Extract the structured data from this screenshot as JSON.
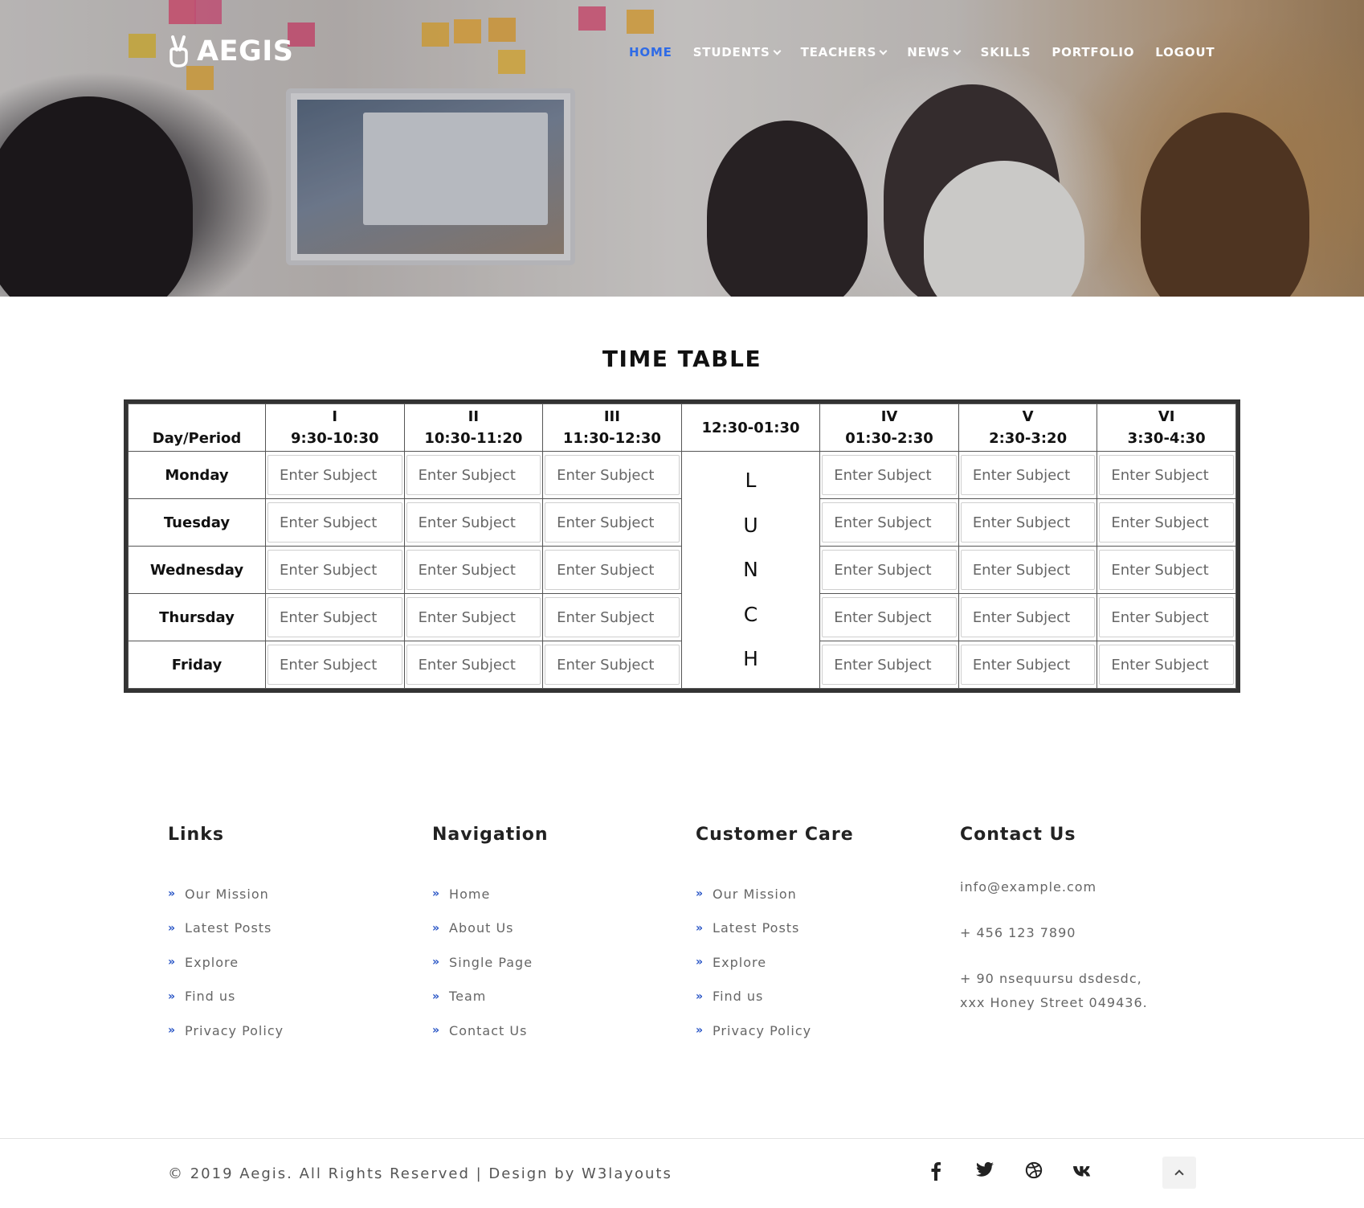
{
  "brand": {
    "name": "AEGIS",
    "icon": "victory-hand-icon"
  },
  "nav": {
    "items": [
      {
        "label": "HOME",
        "active": true,
        "dropdown": false
      },
      {
        "label": "STUDENTS",
        "active": false,
        "dropdown": true
      },
      {
        "label": "TEACHERS",
        "active": false,
        "dropdown": true
      },
      {
        "label": "NEWS",
        "active": false,
        "dropdown": true
      },
      {
        "label": "SKILLS",
        "active": false,
        "dropdown": false
      },
      {
        "label": "PORTFOLIO",
        "active": false,
        "dropdown": false
      },
      {
        "label": "LOGOUT",
        "active": false,
        "dropdown": false
      }
    ],
    "active_color": "#2f6be6"
  },
  "timetable": {
    "title": "TIME TABLE",
    "corner_label": "Day/Period",
    "periods": [
      {
        "numeral": "I",
        "time": "9:30-10:30"
      },
      {
        "numeral": "II",
        "time": "10:30-11:20"
      },
      {
        "numeral": "III",
        "time": "11:30-12:30"
      },
      {
        "numeral": "",
        "time": "12:30-01:30"
      },
      {
        "numeral": "IV",
        "time": "01:30-2:30"
      },
      {
        "numeral": "V",
        "time": "2:30-3:20"
      },
      {
        "numeral": "VI",
        "time": "3:30-4:30"
      }
    ],
    "days": [
      "Monday",
      "Tuesday",
      "Wednesday",
      "Thursday",
      "Friday"
    ],
    "cell_placeholder": "Enter Subject",
    "lunch_letters": [
      "L",
      "U",
      "N",
      "C",
      "H"
    ]
  },
  "footer": {
    "links": {
      "heading": "Links",
      "items": [
        "Our Mission",
        "Latest Posts",
        "Explore",
        "Find us",
        "Privacy Policy"
      ]
    },
    "navigation": {
      "heading": "Navigation",
      "items": [
        "Home",
        "About Us",
        "Single Page",
        "Team",
        "Contact Us"
      ]
    },
    "customer_care": {
      "heading": "Customer Care",
      "items": [
        "Our Mission",
        "Latest Posts",
        "Explore",
        "Find us",
        "Privacy Policy"
      ]
    },
    "contact": {
      "heading": "Contact Us",
      "email": "info@example.com",
      "phone": "+ 456 123 7890",
      "address_line1": "+ 90 nsequursu dsdesdc,",
      "address_line2": "xxx Honey Street 049436."
    },
    "copyright": "© 2019 Aegis. All Rights Reserved | Design by W3layouts",
    "social": [
      "facebook-icon",
      "twitter-icon",
      "dribbble-icon",
      "vk-icon"
    ],
    "accent_color": "#2a56c6"
  }
}
